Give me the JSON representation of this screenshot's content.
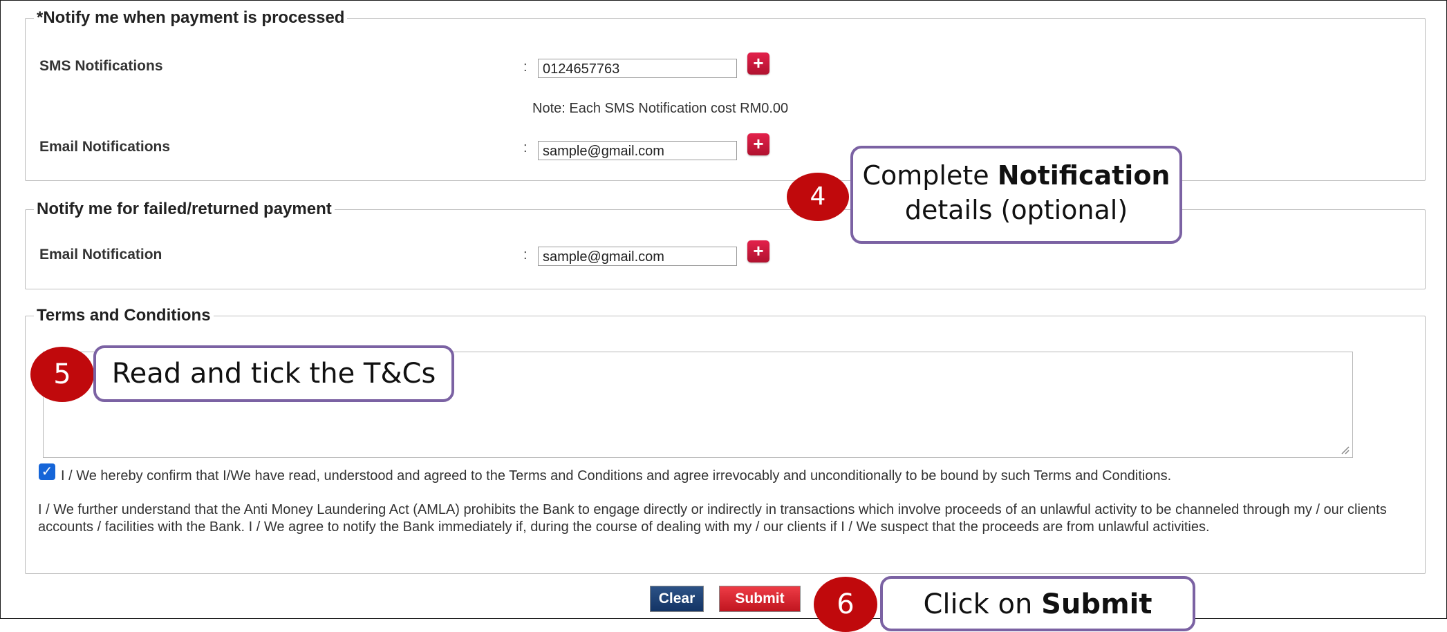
{
  "sections": {
    "notify_processed": {
      "legend": "*Notify me when payment is processed",
      "sms_label": "SMS Notifications",
      "sms_value": "0124657763",
      "sms_note": "Note: Each SMS Notification cost RM0.00",
      "email_label": "Email Notifications",
      "email_value": "sample@gmail.com",
      "colon": ":"
    },
    "notify_failed": {
      "legend": "Notify me for failed/returned payment",
      "email_label": "Email Notification",
      "email_value": "sample@gmail.com",
      "colon": ":"
    },
    "terms": {
      "legend": "Terms and Conditions",
      "confirm_text": "I / We hereby confirm that I/We have read, understood and agreed to the Terms and Conditions and agree irrevocably and unconditionally to be bound by such Terms and Conditions.",
      "aml_text": "I / We further understand that the Anti Money Laundering Act (AMLA) prohibits the Bank to engage directly or indirectly in transactions which involve proceeds of an unlawful activity to be channeled through my / our clients accounts / facilities with the Bank. I / We agree to notify the Bank immediately if, during the course of dealing with my / our clients if I / We suspect that the proceeds are from unlawful activities.",
      "checked": true
    }
  },
  "buttons": {
    "plus_symbol": "+",
    "clear": "Clear",
    "submit": "Submit"
  },
  "callouts": {
    "step4": {
      "number": "4",
      "line1_prefix": "Complete ",
      "line1_bold": "Notification",
      "line2": "details (optional)"
    },
    "step5": {
      "number": "5",
      "text": "Read and tick the T&Cs"
    },
    "step6": {
      "number": "6",
      "prefix": "Click on ",
      "bold": "Submit"
    }
  },
  "colors": {
    "badge_red": "#c0090c",
    "callout_border": "#7b62a3",
    "plus_red": "#d01a3d",
    "clear_blue": "#1f4478",
    "submit_red": "#d9242e",
    "checkbox_blue": "#1565d8"
  }
}
